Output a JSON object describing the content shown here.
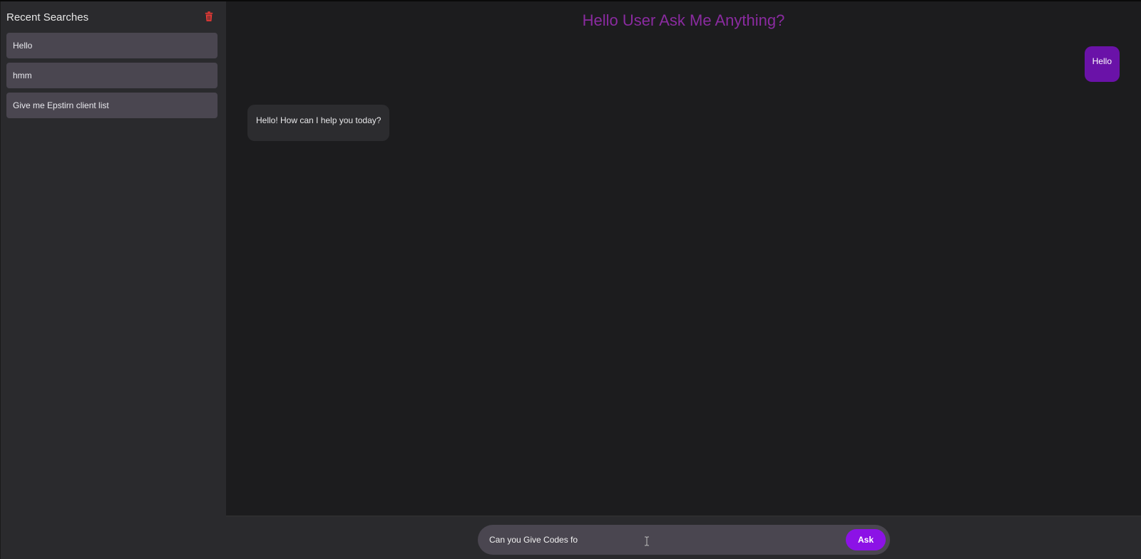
{
  "sidebar": {
    "title": "Recent Searches",
    "clear_icon": "trash-icon",
    "clear_color": "#e53935",
    "items": [
      {
        "label": "Hello"
      },
      {
        "label": "hmm"
      },
      {
        "label": "Give me Epstirn client list"
      }
    ]
  },
  "main": {
    "title": "Hello User Ask Me Anything?",
    "title_color": "#8a2ba0",
    "messages": [
      {
        "role": "user",
        "text": "Hello"
      },
      {
        "role": "bot",
        "text": "Hello! How can I help you today?"
      }
    ]
  },
  "composer": {
    "value": "Can you Give Codes fo",
    "ask_label": "Ask",
    "ask_color": "#8c12e6"
  }
}
